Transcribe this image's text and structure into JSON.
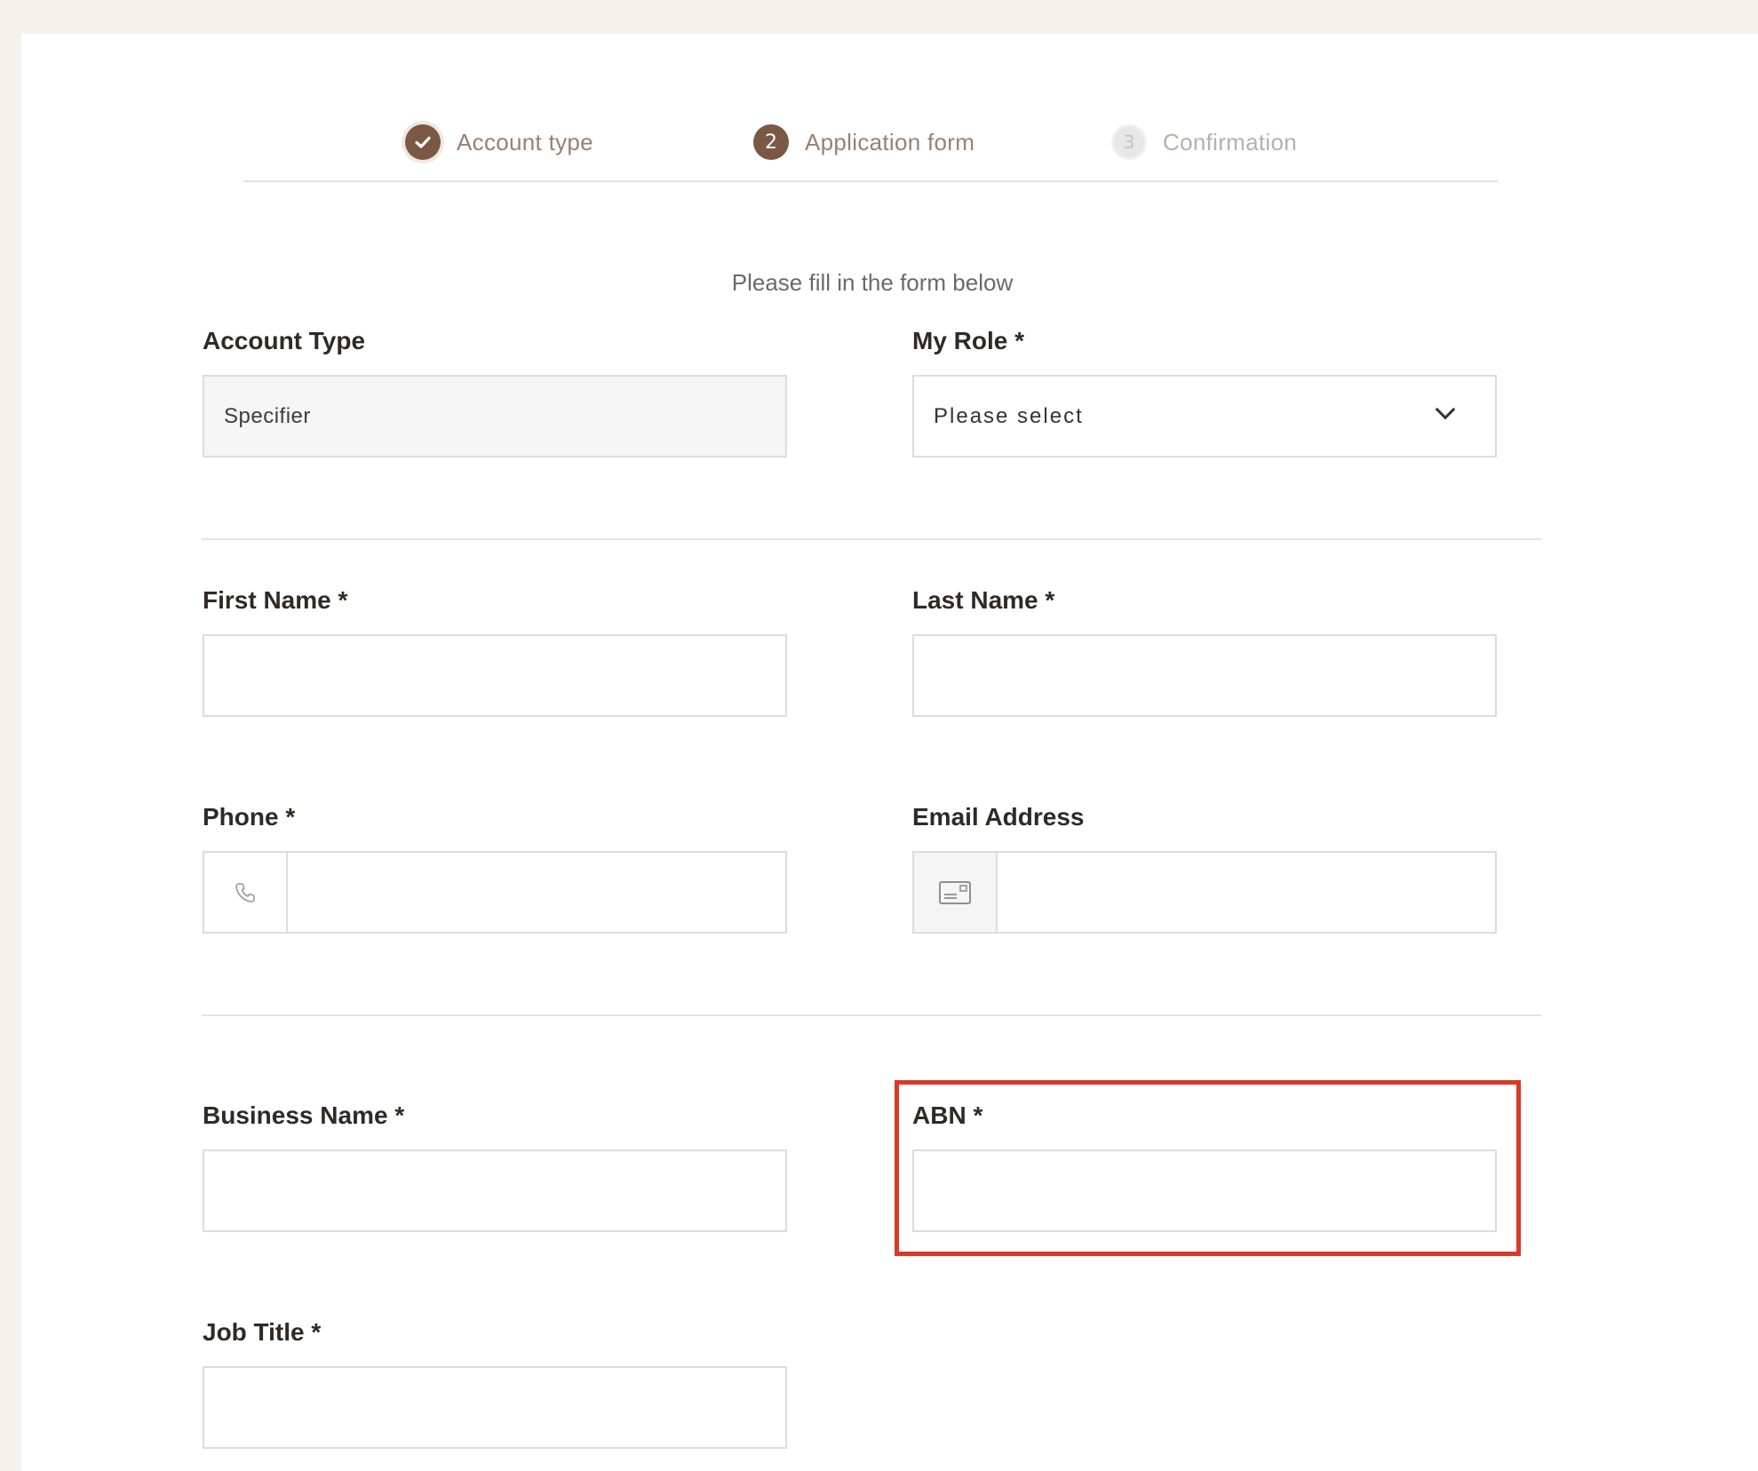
{
  "stepper": {
    "steps": [
      {
        "number": "1",
        "label": "Account type",
        "state": "completed",
        "icon": "check-icon"
      },
      {
        "number": "2",
        "label": "Application form",
        "state": "current",
        "icon": "step-number-icon"
      },
      {
        "number": "3",
        "label": "Confirmation",
        "state": "upcoming",
        "icon": "step-number-icon"
      }
    ]
  },
  "intro": {
    "text": "Please fill in the form below"
  },
  "form": {
    "account_type": {
      "label": "Account Type",
      "value": "Specifier"
    },
    "my_role": {
      "label": "My Role *",
      "selected": "Please select",
      "icon": "chevron-down-icon"
    },
    "first_name": {
      "label": "First Name *",
      "value": ""
    },
    "last_name": {
      "label": "Last Name *",
      "value": ""
    },
    "phone": {
      "label": "Phone *",
      "value": "",
      "icon": "phone-icon"
    },
    "email": {
      "label": "Email Address",
      "value": "",
      "icon": "email-card-icon"
    },
    "business_name": {
      "label": "Business Name *",
      "value": ""
    },
    "abn": {
      "label": "ABN *",
      "value": "",
      "highlighted": true
    },
    "job_title": {
      "label": "Job Title *",
      "value": ""
    }
  },
  "colors": {
    "page_background": "#f5f2ed",
    "brand": "#7a5844",
    "highlight": "#d83a2a",
    "border": "#dcdcdc"
  }
}
